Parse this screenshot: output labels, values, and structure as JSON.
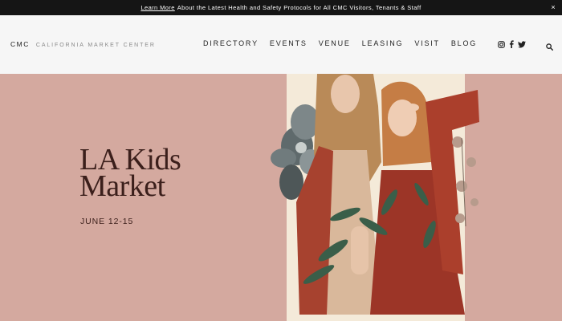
{
  "announcement": {
    "link": "Learn More",
    "text": "About the Latest Health and Safety Protocols for All CMC Visitors, Tenants & Staff",
    "close": "×"
  },
  "brand": {
    "logo": "CMC",
    "name": "CALIFORNIA MARKET CENTER"
  },
  "nav": {
    "items": [
      "DIRECTORY",
      "EVENTS",
      "VENUE",
      "LEASING",
      "VISIT",
      "BLOG"
    ]
  },
  "social": {
    "icons": [
      "instagram-icon",
      "facebook-icon",
      "twitter-icon"
    ]
  },
  "search": {
    "icon": "search-icon"
  },
  "hero": {
    "title_line1": "LA Kids",
    "title_line2": "Market",
    "date": "JUNE 12-15"
  },
  "colors": {
    "background": "#d4a99f",
    "header": "#f6f6f6",
    "announcement": "#151515",
    "title": "#3b1f1b"
  }
}
